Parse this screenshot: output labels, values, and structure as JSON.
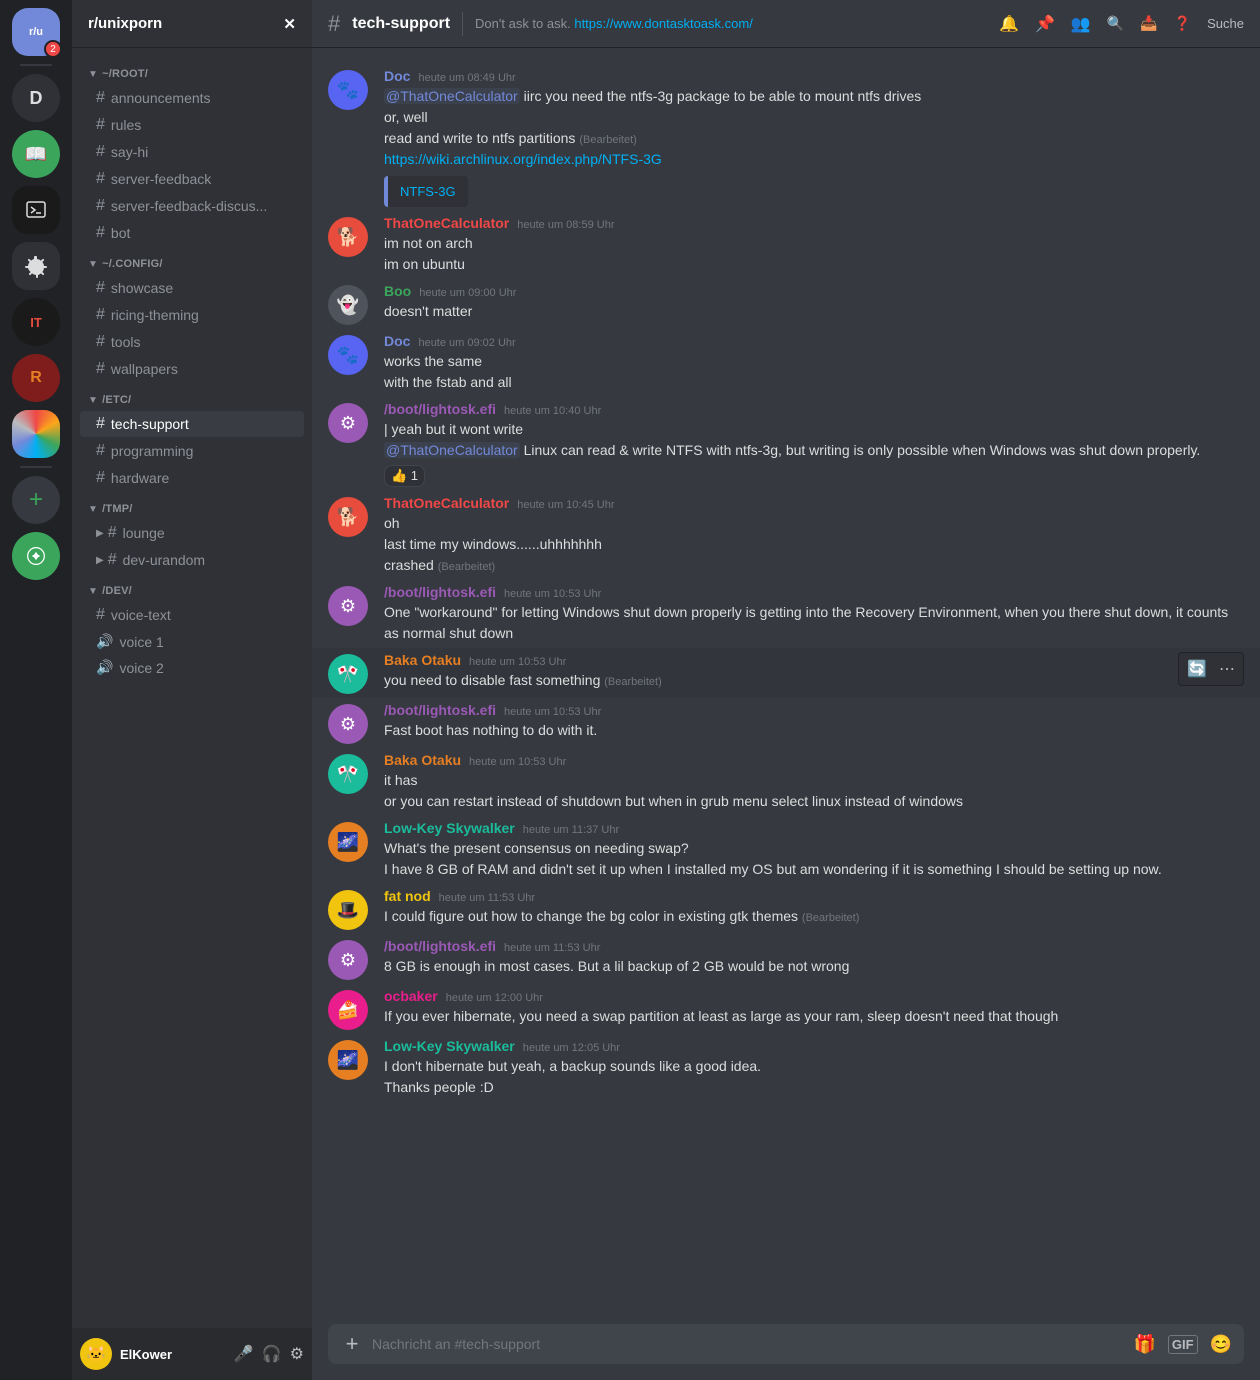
{
  "serverBar": {
    "servers": [
      {
        "id": "r-unixporn",
        "label": "r/unixporn",
        "icon": "🐧",
        "badge": "2",
        "active": true
      },
      {
        "id": "d",
        "label": "D",
        "icon": "D",
        "color": "#2f3136"
      },
      {
        "id": "book",
        "label": "📖",
        "icon": "📖"
      },
      {
        "id": "terminal",
        "label": "⌨",
        "icon": "⌨",
        "color": "#1a1a1a"
      },
      {
        "id": "gear",
        "label": "⚙",
        "icon": "⚙",
        "color": "#2f3136"
      },
      {
        "id": "it",
        "label": "IT",
        "icon": "IT",
        "color": "#1a1a1a"
      },
      {
        "id": "r2",
        "label": "R",
        "icon": "R",
        "color": "#2a0000"
      },
      {
        "id": "art",
        "label": "🎨",
        "icon": "🎨"
      }
    ],
    "addLabel": "+"
  },
  "sidebar": {
    "serverName": "r/unixporn",
    "categories": [
      {
        "name": "~/ROOT/",
        "collapsed": false,
        "channels": [
          {
            "id": "announcements",
            "name": "announcements",
            "type": "text"
          },
          {
            "id": "rules",
            "name": "rules",
            "type": "text"
          },
          {
            "id": "say-hi",
            "name": "say-hi",
            "type": "text"
          },
          {
            "id": "server-feedback",
            "name": "server-feedback",
            "type": "text"
          },
          {
            "id": "server-feedback-discus",
            "name": "server-feedback-discus...",
            "type": "text"
          },
          {
            "id": "bot",
            "name": "bot",
            "type": "text"
          }
        ]
      },
      {
        "name": "~/.CONFIG/",
        "collapsed": false,
        "channels": [
          {
            "id": "showcase",
            "name": "showcase",
            "type": "text"
          },
          {
            "id": "ricing-theming",
            "name": "ricing-theming",
            "type": "text"
          },
          {
            "id": "tools",
            "name": "tools",
            "type": "text"
          },
          {
            "id": "wallpapers",
            "name": "wallpapers",
            "type": "text"
          }
        ]
      },
      {
        "name": "/ETC/",
        "collapsed": false,
        "channels": [
          {
            "id": "tech-support",
            "name": "tech-support",
            "type": "text",
            "active": true
          },
          {
            "id": "programming",
            "name": "programming",
            "type": "text"
          },
          {
            "id": "hardware",
            "name": "hardware",
            "type": "text"
          }
        ]
      },
      {
        "name": "/TMP/",
        "collapsed": false,
        "channels": [
          {
            "id": "lounge",
            "name": "lounge",
            "type": "text"
          },
          {
            "id": "dev-urandom",
            "name": "dev-urandom",
            "type": "text"
          }
        ]
      },
      {
        "name": "/DEV/",
        "collapsed": false,
        "channels": [
          {
            "id": "voice-text",
            "name": "voice-text",
            "type": "text"
          },
          {
            "id": "voice-1",
            "name": "voice 1",
            "type": "voice"
          },
          {
            "id": "voice-2",
            "name": "voice 2",
            "type": "voice"
          }
        ]
      }
    ],
    "currentUser": {
      "name": "ElKower",
      "discriminator": "",
      "avatarColor": "av-gold",
      "avatarText": "🐱"
    }
  },
  "channel": {
    "name": "tech-support",
    "topic": "Don't ask to ask.",
    "topicLink": "https://www.dontasktoask.com/",
    "topicLinkText": "https://www.dontasktoask.com/"
  },
  "messages": [
    {
      "id": "msg1",
      "author": "Doc",
      "authorClass": "author-doc",
      "avatarColor": "av-blue",
      "avatarText": "🐾",
      "timestamp": "heute um 08:49 Uhr",
      "lines": [
        {
          "type": "mention-text",
          "mention": "@ThatOneCalculator",
          "text": " iirc you need the ntfs-3g package to be able to mount ntfs drives"
        },
        {
          "type": "text",
          "text": "or, well"
        },
        {
          "type": "text-edited",
          "text": "read and write to ntfs partitions",
          "edited": "(Bearbeitet)"
        },
        {
          "type": "link",
          "href": "https://wiki.archlinux.org/index.php/NTFS-3G",
          "text": "https://wiki.archlinux.org/index.php/NTFS-3G"
        }
      ],
      "embed": "NTFS-3G"
    },
    {
      "id": "msg2",
      "author": "ThatOneCalculator",
      "authorClass": "author-thatone",
      "avatarColor": "av-red",
      "avatarText": "🐕",
      "timestamp": "heute um 08:59 Uhr",
      "lines": [
        {
          "type": "text",
          "text": "im not on arch"
        },
        {
          "type": "text",
          "text": "im on ubuntu"
        }
      ]
    },
    {
      "id": "msg3",
      "author": "Boo",
      "authorClass": "author-boo",
      "avatarColor": "av-dark",
      "avatarText": "👻",
      "timestamp": "heute um 09:00 Uhr",
      "lines": [
        {
          "type": "text",
          "text": "doesn't matter"
        }
      ]
    },
    {
      "id": "msg4",
      "author": "Doc",
      "authorClass": "author-doc",
      "avatarColor": "av-blue",
      "avatarText": "🐾",
      "timestamp": "heute um 09:02 Uhr",
      "lines": [
        {
          "type": "text",
          "text": "works the same"
        },
        {
          "type": "text",
          "text": "with the fstab and all"
        }
      ]
    },
    {
      "id": "msg5",
      "author": "/boot/lightosk.efi",
      "authorClass": "author-lightosk",
      "avatarColor": "av-purple",
      "avatarText": "⚙",
      "timestamp": "heute um 10:40 Uhr",
      "lines": [
        {
          "type": "bar-text",
          "text": "yeah but it wont write"
        },
        {
          "type": "mention-text",
          "mention": "@ThatOneCalculator",
          "text": " Linux can read & write NTFS with ntfs-3g, but writing is only possible when Windows was shut down properly."
        }
      ],
      "reaction": {
        "emoji": "👍",
        "count": "1"
      }
    },
    {
      "id": "msg6",
      "author": "ThatOneCalculator",
      "authorClass": "author-thatone",
      "avatarColor": "av-red",
      "avatarText": "🐕",
      "timestamp": "heute um 10:45 Uhr",
      "lines": [
        {
          "type": "text",
          "text": "oh"
        },
        {
          "type": "text",
          "text": "last time my windows......uhhhhhhh"
        },
        {
          "type": "text-edited",
          "text": "crashed",
          "edited": "(Bearbeitet)"
        }
      ]
    },
    {
      "id": "msg7",
      "author": "/boot/lightosk.efi",
      "authorClass": "author-lightosk",
      "avatarColor": "av-purple",
      "avatarText": "⚙",
      "timestamp": "heute um 10:53 Uhr",
      "lines": [
        {
          "type": "text",
          "text": "One \"workaround\" for letting Windows shut down properly is getting into the Recovery Environment, when you there shut down, it counts as normal shut down"
        }
      ]
    },
    {
      "id": "msg8",
      "author": "Baka Otaku",
      "authorClass": "author-bakaotaku",
      "avatarColor": "av-teal",
      "avatarText": "🎌",
      "timestamp": "heute um 10:53 Uhr",
      "lines": [
        {
          "type": "text-edited",
          "text": "you need to disable fast something",
          "edited": "(Bearbeitet)"
        }
      ],
      "hoverActions": true
    },
    {
      "id": "msg9",
      "author": "/boot/lightosk.efi",
      "authorClass": "author-lightosk",
      "avatarColor": "av-purple",
      "avatarText": "⚙",
      "timestamp": "heute um 10:53 Uhr",
      "lines": [
        {
          "type": "text",
          "text": "Fast boot has nothing to do with it."
        }
      ]
    },
    {
      "id": "msg10",
      "author": "Baka Otaku",
      "authorClass": "author-bakaotaku",
      "avatarColor": "av-teal",
      "avatarText": "🎌",
      "timestamp": "heute um 10:53 Uhr",
      "lines": [
        {
          "type": "text",
          "text": "it has"
        },
        {
          "type": "text",
          "text": "or you can restart instead of shutdown but when in grub menu select linux instead of windows"
        }
      ]
    },
    {
      "id": "msg11",
      "author": "Low-Key Skywalker",
      "authorClass": "author-lowkey",
      "avatarColor": "av-orange",
      "avatarText": "🌌",
      "timestamp": "heute um 11:37 Uhr",
      "lines": [
        {
          "type": "text",
          "text": "What's the present consensus on needing swap?"
        },
        {
          "type": "text",
          "text": "I have 8 GB of RAM and didn't set it up when I installed my OS but am wondering if it is something I should be setting up now."
        }
      ]
    },
    {
      "id": "msg12",
      "author": "fat nod",
      "authorClass": "author-fatnod",
      "avatarColor": "av-gold",
      "avatarText": "🎩",
      "timestamp": "heute um 11:53 Uhr",
      "lines": [
        {
          "type": "text-edited",
          "text": "I could figure out how to change the bg color in existing gtk themes",
          "edited": "(Bearbeitet)"
        }
      ]
    },
    {
      "id": "msg13",
      "author": "/boot/lightosk.efi",
      "authorClass": "author-lightosk",
      "avatarColor": "av-purple",
      "avatarText": "⚙",
      "timestamp": "heute um 11:53 Uhr",
      "lines": [
        {
          "type": "text",
          "text": "8 GB is enough in most cases. But a lil backup of 2 GB would be not wrong"
        }
      ]
    },
    {
      "id": "msg14",
      "author": "ocbaker",
      "authorClass": "author-ocbaker",
      "avatarColor": "av-pink",
      "avatarText": "🍰",
      "timestamp": "heute um 12:00 Uhr",
      "lines": [
        {
          "type": "text",
          "text": "If you ever hibernate, you need a swap partition at least as large as your ram, sleep doesn't need that though"
        }
      ]
    },
    {
      "id": "msg15",
      "author": "Low-Key Skywalker",
      "authorClass": "author-lowkey",
      "avatarColor": "av-orange",
      "avatarText": "🌌",
      "timestamp": "heute um 12:05 Uhr",
      "lines": [
        {
          "type": "text",
          "text": "I don't hibernate but yeah, a backup sounds like a good idea."
        },
        {
          "type": "text",
          "text": "Thanks people :D"
        }
      ]
    }
  ],
  "inputPlaceholder": "Nachricht an #tech-support",
  "ui": {
    "searchPlaceholder": "Suche",
    "notificationIcon": "🔔",
    "pinIcon": "📌",
    "membersIcon": "👥",
    "searchIconHeader": "🔍",
    "inboxIcon": "📥",
    "helpIcon": "❓",
    "micIcon": "🎤",
    "headphonesIcon": "🎧",
    "settingsIcon": "⚙"
  }
}
